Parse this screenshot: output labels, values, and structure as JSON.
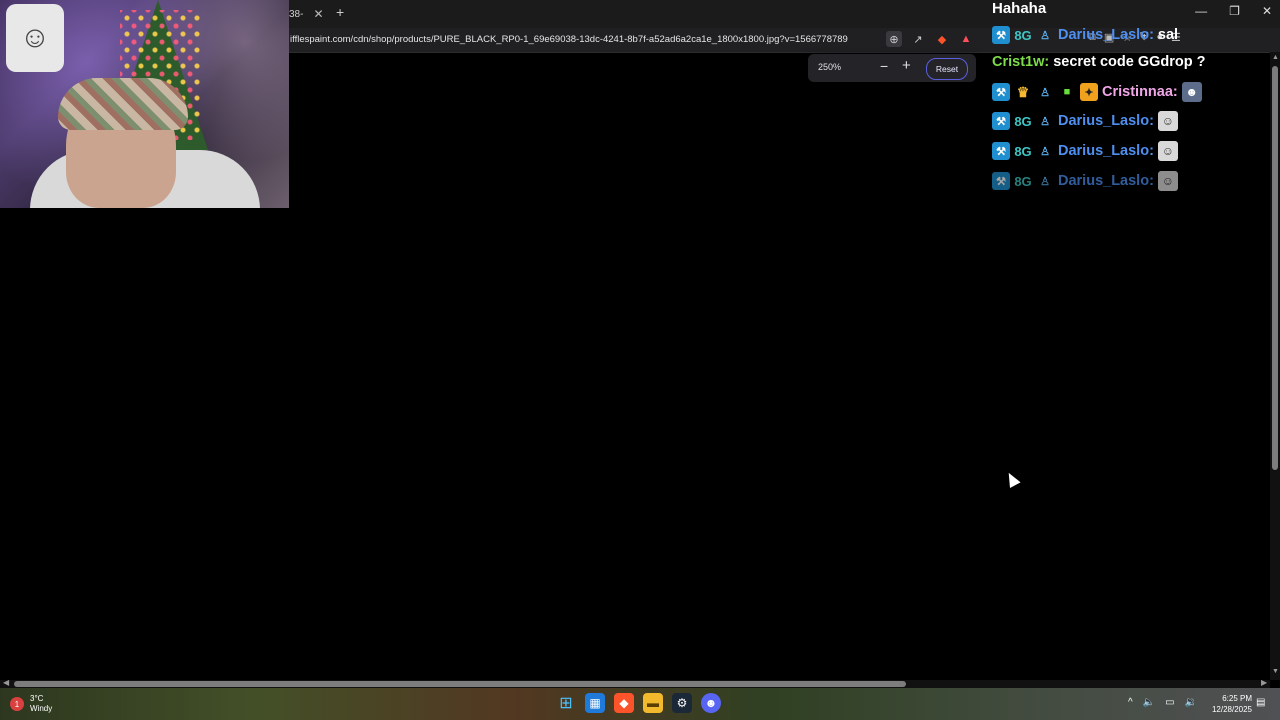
{
  "browser": {
    "tab_fragment": "38-",
    "tab_close": "✕",
    "new_tab": "+",
    "url": "ifflespaint.com/cdn/shop/products/PURE_BLACK_RP0-1_69e69038-13dc-4241-8b7f-a52ad6a2ca1e_1800x1800.jpg?v=1566778789",
    "window_controls": {
      "minimize": "—",
      "maximize": "❐",
      "close": "✕"
    }
  },
  "zoom_popup": {
    "level": "250%",
    "minus": "−",
    "plus": "+",
    "reset": "Reset"
  },
  "chat": {
    "top_text": "Hahaha",
    "messages": [
      {
        "user": "Darius_Laslo:",
        "text": "sal"
      },
      {
        "user": "Crist1w:",
        "text": "secret code GGdrop ?"
      },
      {
        "user": "Cristinnaa:",
        "text": ""
      },
      {
        "user": "Darius_Laslo:",
        "text": ""
      },
      {
        "user": "Darius_Laslo:",
        "text": ""
      },
      {
        "user": "Darius_Laslo:",
        "text": ""
      }
    ]
  },
  "taskbar": {
    "weather_temp": "3°C",
    "weather_desc": "Windy",
    "weather_badge": "1",
    "time": "6:25 PM",
    "date": "12/28/2025"
  },
  "colors": {
    "accent_reset": "#5b5fe0",
    "chat_user_blue": "#4e8ff0",
    "chat_user_green": "#7ddc4a",
    "chat_user_pink": "#f1a6e8"
  }
}
